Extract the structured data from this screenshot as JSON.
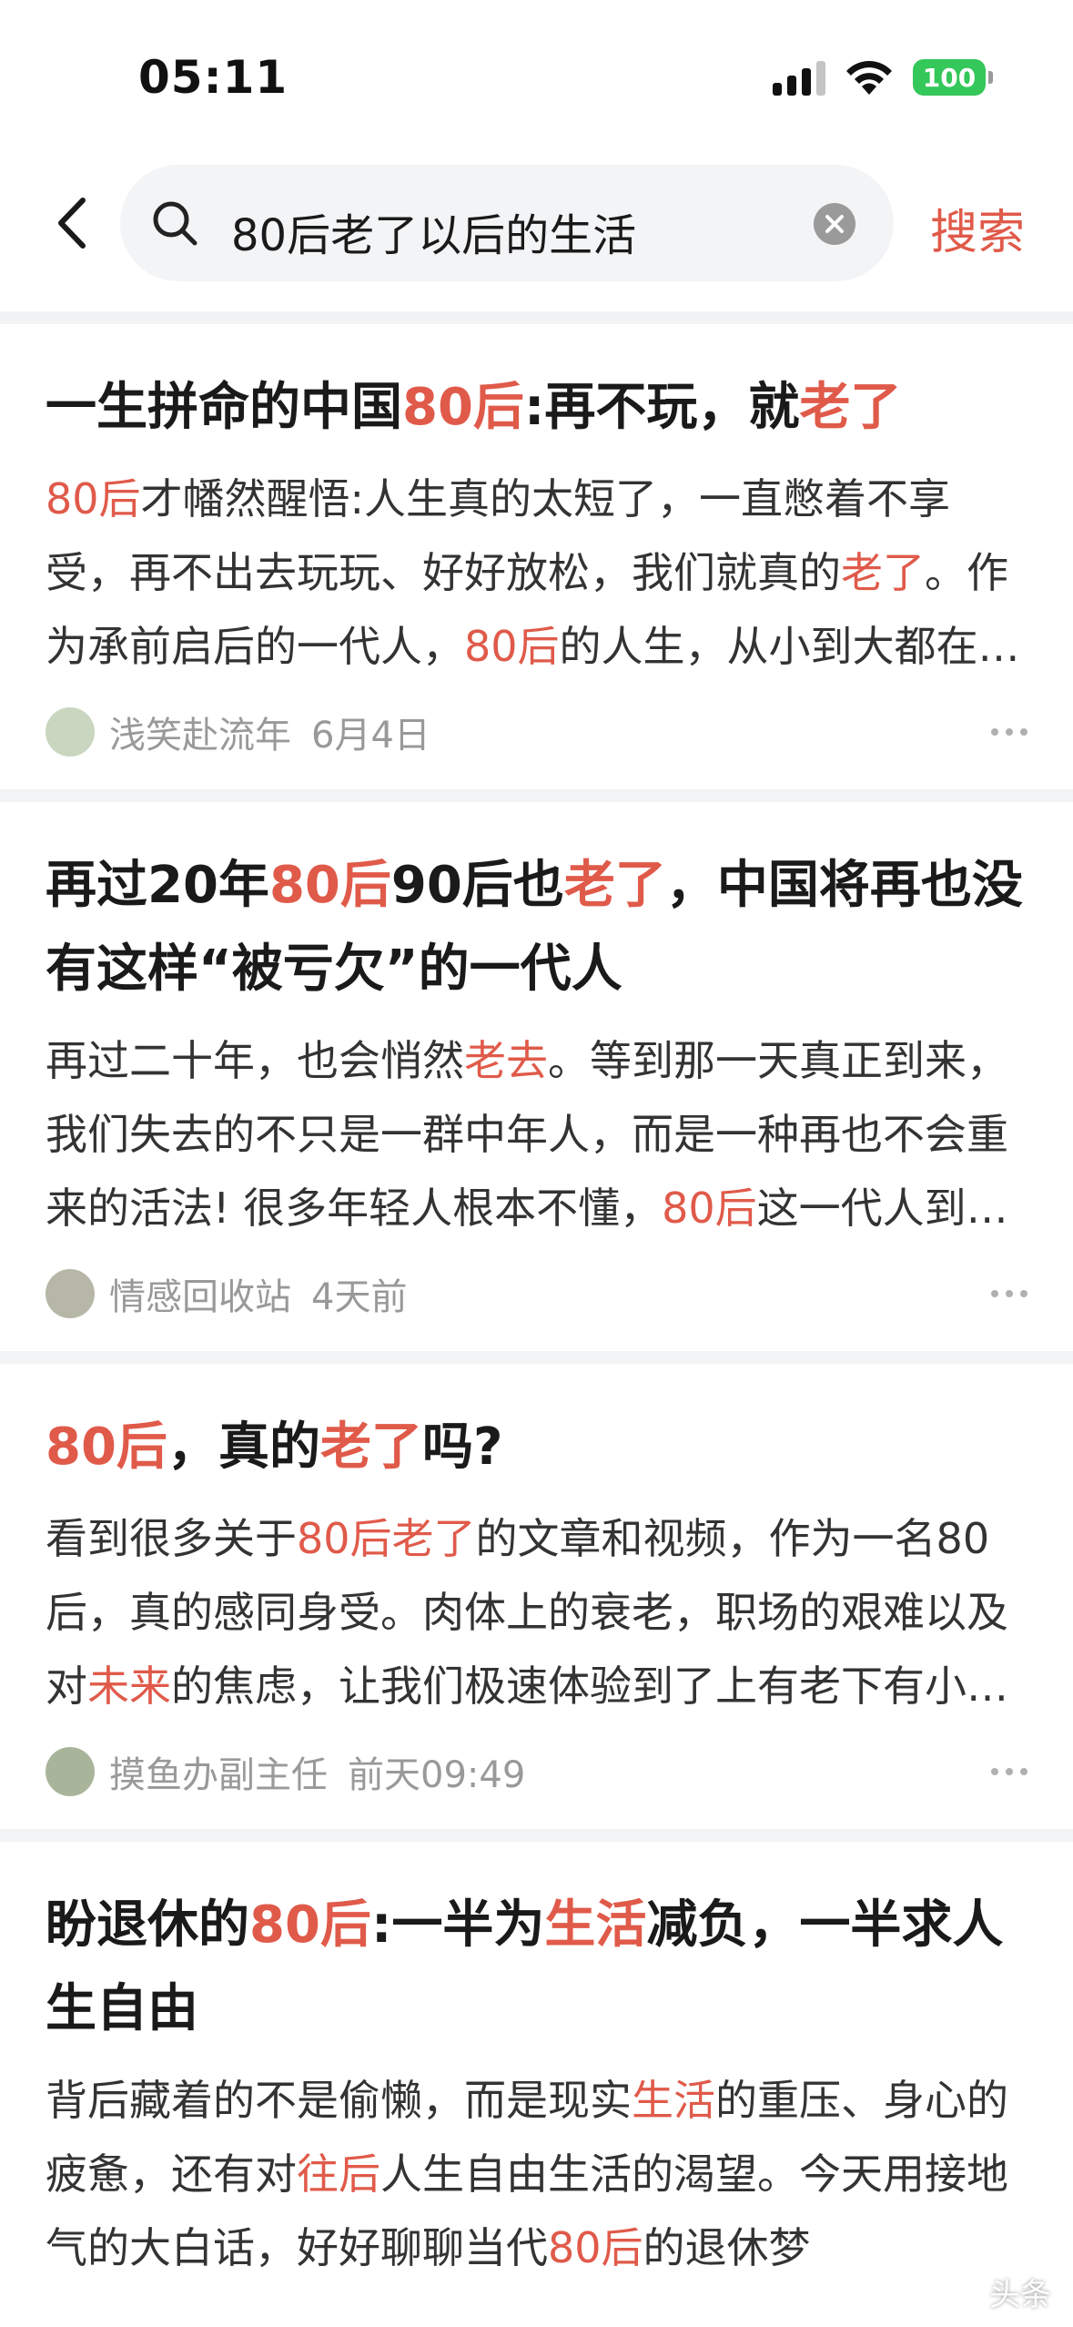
{
  "status_bar": {
    "time": "05:11",
    "battery": "100",
    "colors": {
      "battery": "#34c759"
    }
  },
  "search": {
    "query": "80后老了以后的生活",
    "button_label": "搜索",
    "icons": {
      "back": "chevron-left-icon",
      "search": "search-icon",
      "clear": "clear-icon"
    }
  },
  "accent_color": "#e05a4a",
  "articles": [
    {
      "title": [
        {
          "t": "一生拼命的中国",
          "h": false
        },
        {
          "t": "80后",
          "h": true
        },
        {
          "t": ":再不玩，就",
          "h": false
        },
        {
          "t": "老了",
          "h": true
        }
      ],
      "summary": [
        {
          "t": "80后",
          "h": true
        },
        {
          "t": "才幡然醒悟:人生真的太短了，一直憋着不享受，再不出去玩玩、好好放松，我们就真的",
          "h": false
        },
        {
          "t": "老了",
          "h": true
        },
        {
          "t": "。作为承前启后的一代人，",
          "h": false
        },
        {
          "t": "80后",
          "h": true
        },
        {
          "t": "的人生，从小到大都在被推着往前走",
          "h": false
        }
      ],
      "author": "浅笑赴流年",
      "time": "6月4日",
      "avatar_color": "#c9d6c0"
    },
    {
      "title": [
        {
          "t": "再过20年",
          "h": false
        },
        {
          "t": "80后",
          "h": true
        },
        {
          "t": "90后也",
          "h": false
        },
        {
          "t": "老了",
          "h": true
        },
        {
          "t": "，中国将再也没有这样“被亏欠”的一代人",
          "h": false
        }
      ],
      "summary": [
        {
          "t": "再过二十年，也会悄然",
          "h": false
        },
        {
          "t": "老去",
          "h": true
        },
        {
          "t": "。等到那一天真正到来，我们失去的不只是一群中年人，而是一种再也不会重来的活法! 很多年轻人根本不懂，",
          "h": false
        },
        {
          "t": "80后",
          "h": true
        },
        {
          "t": "这一代人到底经历了什么",
          "h": false
        }
      ],
      "author": "情感回收站",
      "time": "4天前",
      "avatar_color": "#b7b7a8"
    },
    {
      "title": [
        {
          "t": "80后",
          "h": true
        },
        {
          "t": "，真的",
          "h": false
        },
        {
          "t": "老了",
          "h": true
        },
        {
          "t": "吗?",
          "h": false
        }
      ],
      "summary": [
        {
          "t": "看到很多关于",
          "h": false
        },
        {
          "t": "80后老了",
          "h": true
        },
        {
          "t": "的文章和视频，作为一名80后，真的感同身受。肉体上的衰老，职场的艰难以及对",
          "h": false
        },
        {
          "t": "未来",
          "h": true
        },
        {
          "t": "的焦虑，让我们极速体验到了上有老下有小的压力",
          "h": false
        }
      ],
      "author": "摸鱼办副主任",
      "time": "前天09:49",
      "avatar_color": "#a9b59a"
    },
    {
      "title": [
        {
          "t": "盼退休的",
          "h": false
        },
        {
          "t": "80后",
          "h": true
        },
        {
          "t": ":一半为",
          "h": false
        },
        {
          "t": "生活",
          "h": true
        },
        {
          "t": "减负，一半求人生自由",
          "h": false
        }
      ],
      "summary": [
        {
          "t": "背后藏着的不是偷懒，而是现实",
          "h": false
        },
        {
          "t": "生活",
          "h": true
        },
        {
          "t": "的重压、身心的疲惫，还有对",
          "h": false
        },
        {
          "t": "往后",
          "h": true
        },
        {
          "t": "人生自由生活的渴望。今天用接地气的大白话，好好聊聊当代",
          "h": false
        },
        {
          "t": "80后",
          "h": true
        },
        {
          "t": "的退休梦",
          "h": false
        }
      ],
      "author": "",
      "time": "",
      "avatar_color": "#cccccc"
    }
  ],
  "watermark": "头条"
}
